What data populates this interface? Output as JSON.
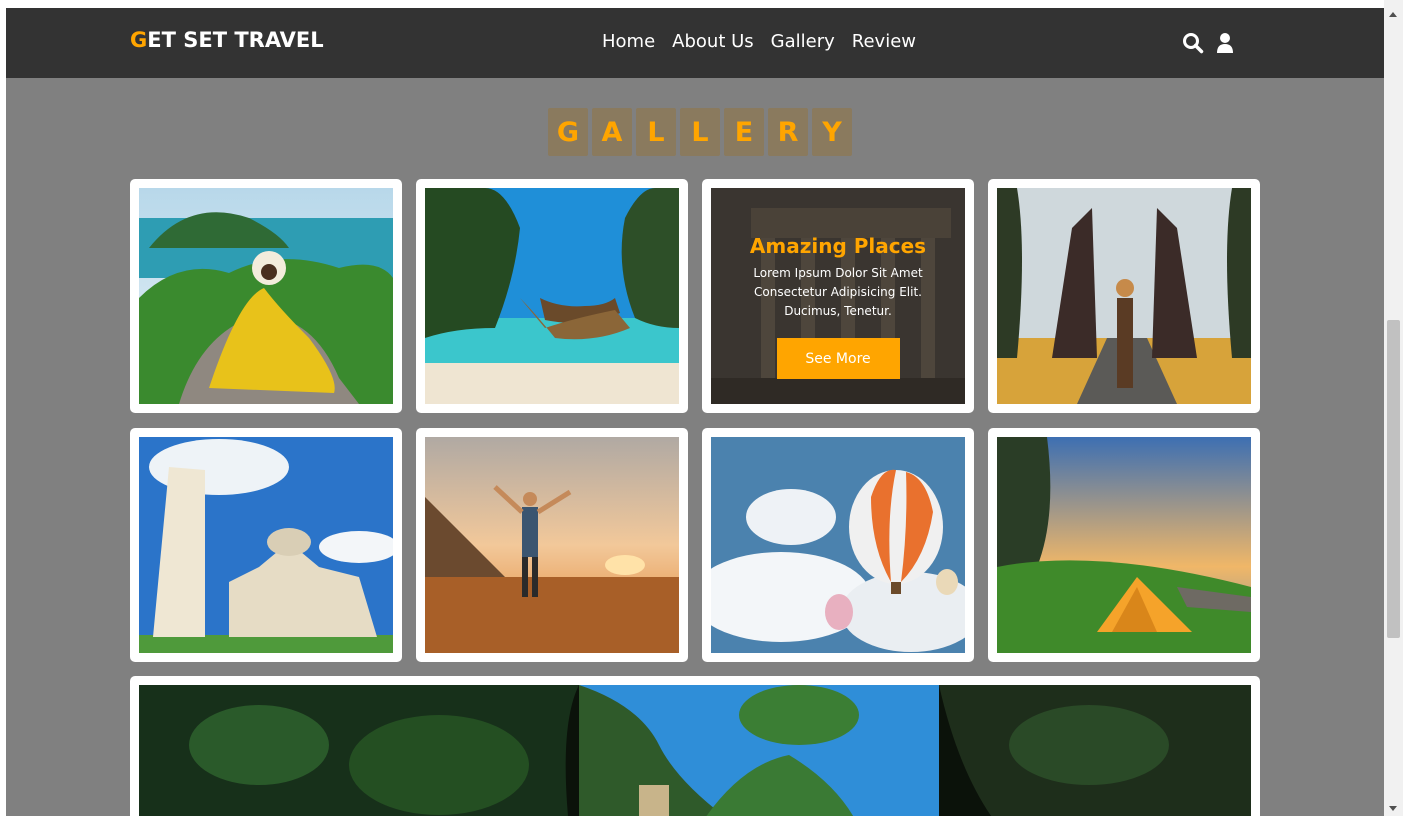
{
  "navbar": {
    "brand_first": "G",
    "brand_rest": "ET SET TRAVEL",
    "links": [
      "Home",
      "About Us",
      "Gallery",
      "Review"
    ],
    "icons": [
      "search-icon",
      "user-icon"
    ]
  },
  "gallery": {
    "heading_letters": [
      "G",
      "A",
      "L",
      "L",
      "E",
      "R",
      "Y"
    ],
    "feature": {
      "title": "Amazing Places",
      "description": "Lorem Ipsum Dolor Sit Amet Consectetur Adipisicing Elit. Ducimus, Tenetur.",
      "button_label": "See More"
    }
  },
  "colors": {
    "accent": "#ffa500",
    "navbar": "#333333",
    "page_background": "#808080"
  }
}
